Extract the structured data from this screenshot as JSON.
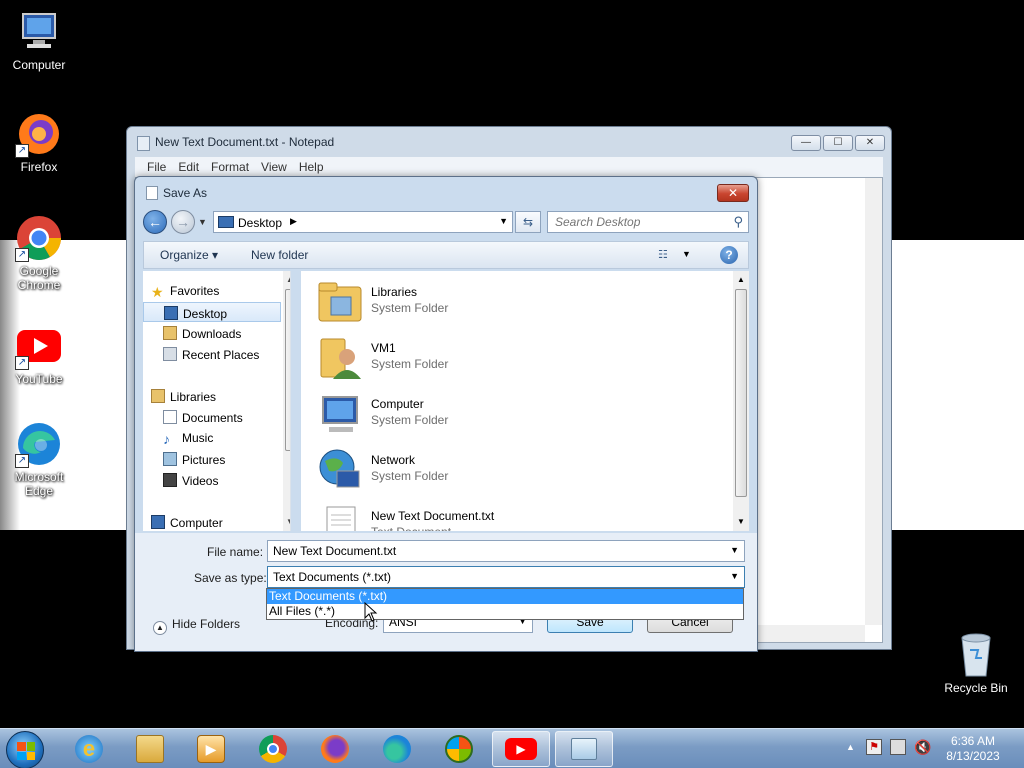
{
  "desktop": {
    "icons": [
      {
        "label": "Computer"
      },
      {
        "label": "Firefox"
      },
      {
        "label": "Google Chrome"
      },
      {
        "label": "YouTube"
      },
      {
        "label": "Microsoft Edge"
      }
    ],
    "recycle_bin": "Recycle Bin"
  },
  "notepad": {
    "title": "New Text Document.txt - Notepad",
    "menu": [
      "File",
      "Edit",
      "Format",
      "View",
      "Help"
    ],
    "window_buttons": {
      "minimize": "—",
      "maximize": "☐",
      "close": "✕"
    }
  },
  "saveas": {
    "title": "Save As",
    "close_label": "✕",
    "address": {
      "crumb": "Desktop"
    },
    "search": {
      "placeholder": "Search Desktop"
    },
    "toolbar": {
      "organize": "Organize ▾",
      "new_folder": "New folder",
      "help": "?"
    },
    "nav": {
      "favorites": "Favorites",
      "desktop": "Desktop",
      "downloads": "Downloads",
      "recent": "Recent Places",
      "libraries": "Libraries",
      "documents": "Documents",
      "music": "Music",
      "pictures": "Pictures",
      "videos": "Videos",
      "computer": "Computer"
    },
    "files": [
      {
        "name": "Libraries",
        "type": "System Folder"
      },
      {
        "name": "VM1",
        "type": "System Folder"
      },
      {
        "name": "Computer",
        "type": "System Folder"
      },
      {
        "name": "Network",
        "type": "System Folder"
      },
      {
        "name": "New Text Document.txt",
        "type": "Text Document"
      }
    ],
    "file_name_label": "File name:",
    "file_name_value": "New Text Document.txt",
    "save_type_label": "Save as type:",
    "save_type_value": "Text Documents (*.txt)",
    "save_type_options": [
      "Text Documents (*.txt)",
      "All Files  (*.*)"
    ],
    "hide_folders": "Hide Folders",
    "encoding_label": "Encoding:",
    "encoding_value": "ANSI",
    "save_button": "Save",
    "cancel_button": "Cancel"
  },
  "taskbar": {
    "clock_time": "6:36 AM",
    "clock_date": "8/13/2023"
  }
}
